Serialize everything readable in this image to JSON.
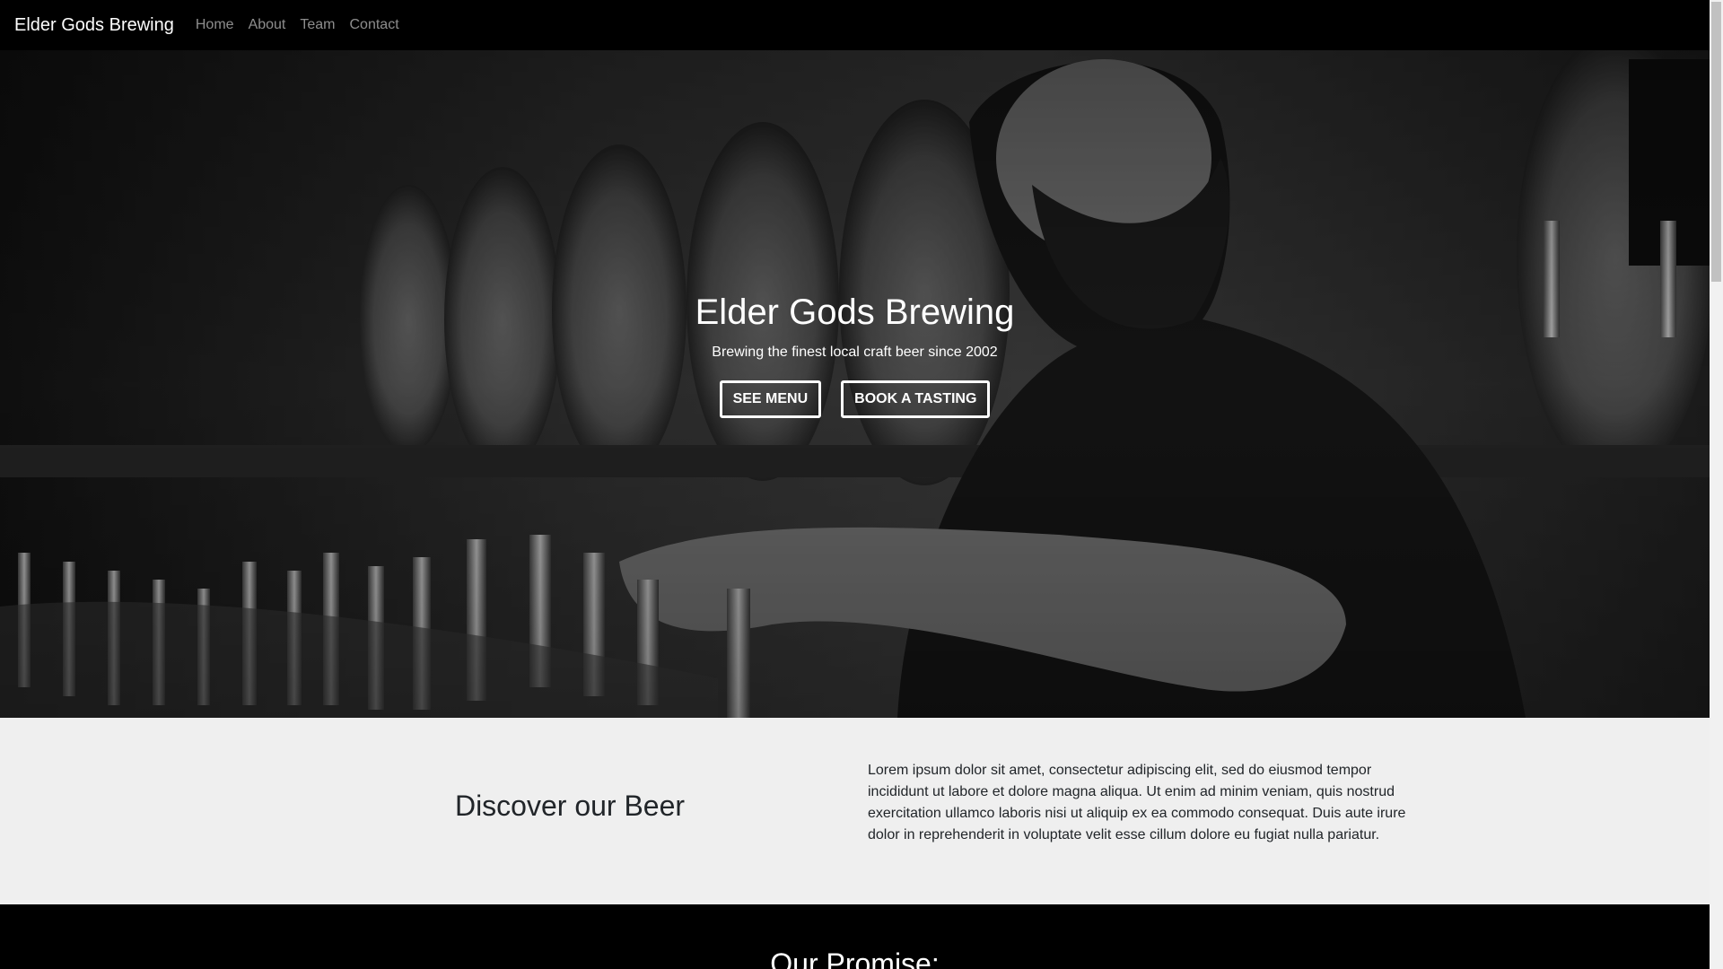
{
  "navbar": {
    "brand": "Elder Gods Brewing",
    "links": [
      "Home",
      "About",
      "Team",
      "Contact"
    ]
  },
  "hero": {
    "title": "Elder Gods Brewing",
    "subtitle": "Brewing the finest local craft beer since 2002",
    "buttons": [
      "SEE MENU",
      "BOOK A TASTING"
    ]
  },
  "discover": {
    "title": "Discover our Beer",
    "text": "Lorem ipsum dolor sit amet, consectetur adipiscing elit, sed do eiusmod tempor incididunt ut labore et dolore magna aliqua. Ut enim ad minim veniam, quis nostrud exercitation ullamco laboris nisi ut aliquip ex ea commodo consequat. Duis aute irure dolor in reprehenderit in voluptate velit esse cillum dolore eu fugiat nulla pariatur."
  },
  "promise": {
    "title": "Our Promise:"
  },
  "colors": {
    "navbar_bg": "#000000",
    "section_bg": "#efefef",
    "text_dark": "#212529",
    "button_border": "#ffffff"
  }
}
